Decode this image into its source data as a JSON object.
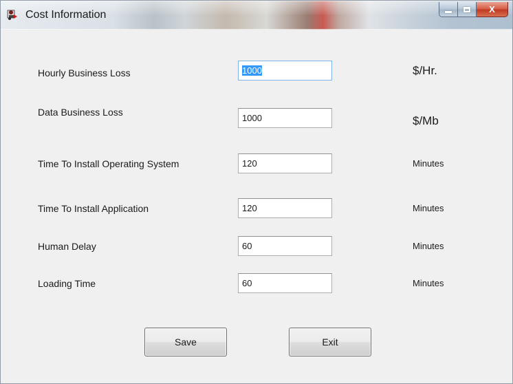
{
  "window": {
    "title": "Cost Information",
    "app_icon": "app-icon",
    "controls": {
      "minimize_icon": "minimize-icon",
      "maximize_icon": "maximize-icon",
      "close_icon": "close-icon",
      "close_glyph": "X"
    }
  },
  "form": {
    "rows": [
      {
        "label": "Hourly Business Loss",
        "value": "1000",
        "unit": "$/Hr."
      },
      {
        "label": "Data Business Loss",
        "value": "1000",
        "unit": "$/Mb"
      },
      {
        "label": "Time To Install Operating System",
        "value": "120",
        "unit": "Minutes"
      },
      {
        "label": "Time To Install Application",
        "value": "120",
        "unit": "Minutes"
      },
      {
        "label": "Human Delay",
        "value": "60",
        "unit": "Minutes"
      },
      {
        "label": "Loading Time",
        "value": "60",
        "unit": "Minutes"
      }
    ]
  },
  "buttons": {
    "save_label": "Save",
    "exit_label": "Exit"
  },
  "colors": {
    "selection": "#3399ff",
    "window_bg": "#f0f0f0",
    "close_button": "#c03a24"
  }
}
